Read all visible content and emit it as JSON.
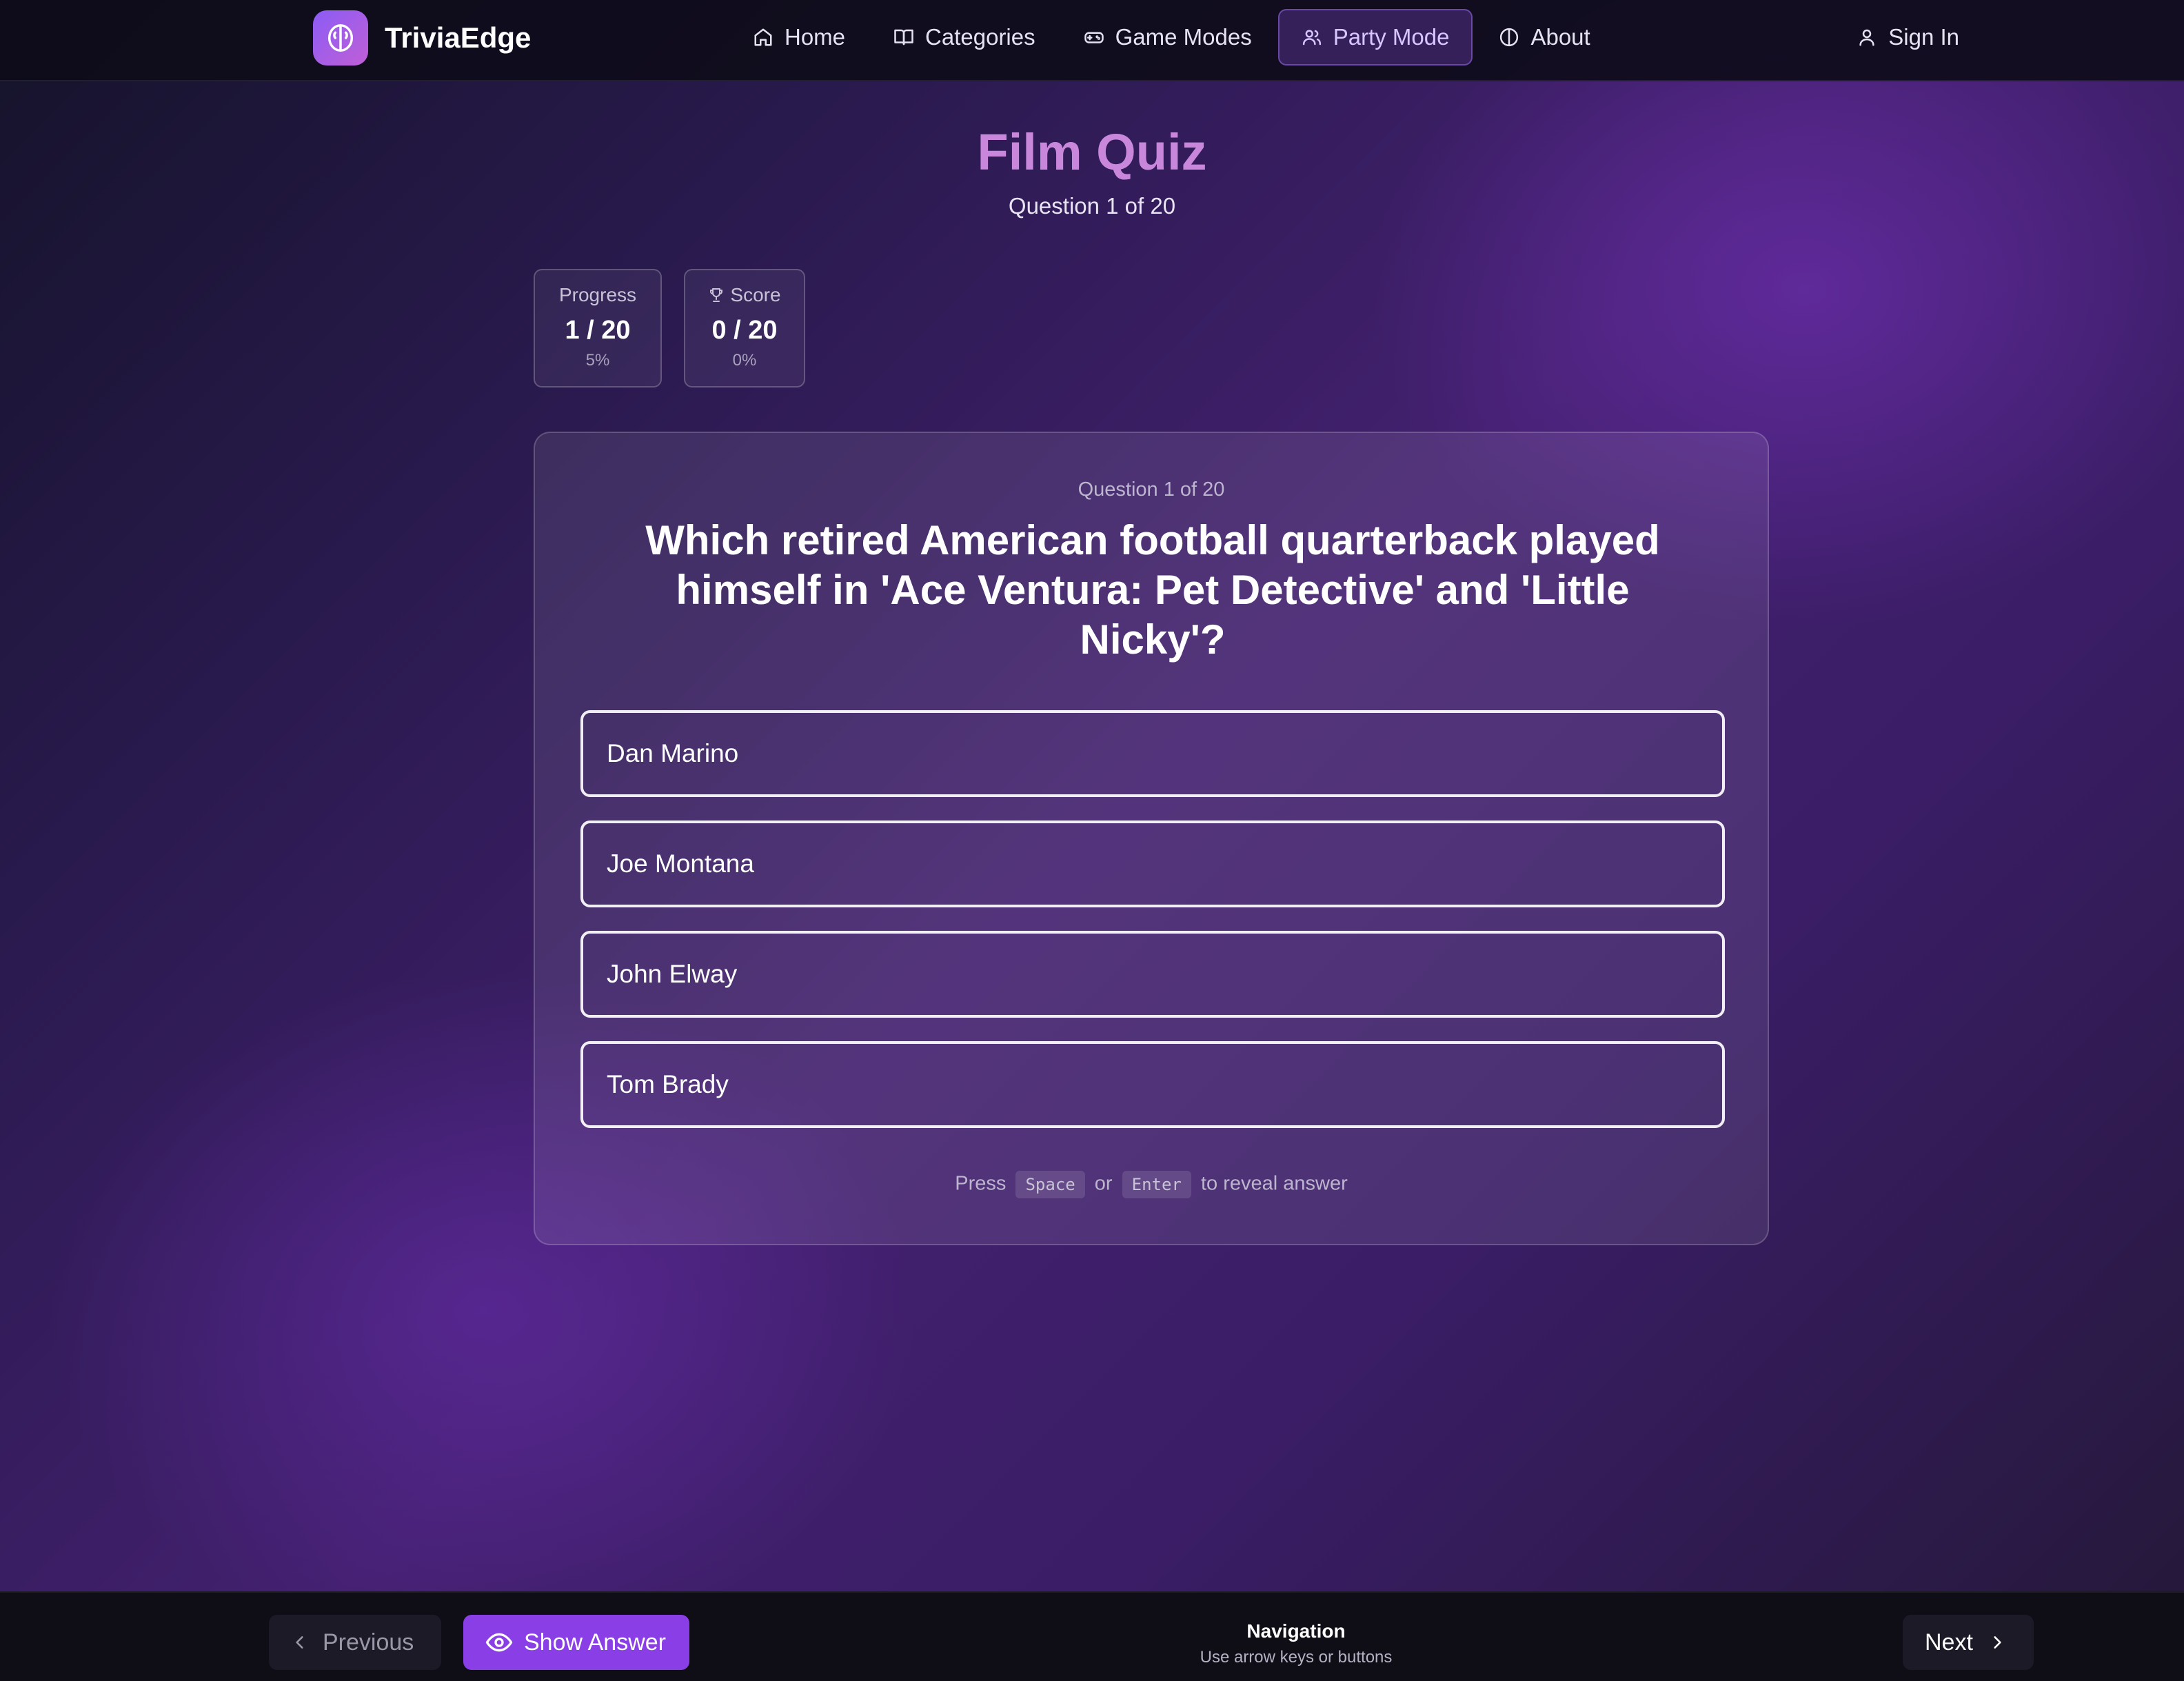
{
  "app": {
    "name": "TriviaEdge"
  },
  "nav": {
    "items": [
      {
        "label": "Home",
        "icon": "home-icon"
      },
      {
        "label": "Categories",
        "icon": "book-icon"
      },
      {
        "label": "Game Modes",
        "icon": "gamepad-icon"
      },
      {
        "label": "Party Mode",
        "icon": "users-icon",
        "active": true
      },
      {
        "label": "About",
        "icon": "info-icon"
      }
    ],
    "sign_in": "Sign In"
  },
  "header": {
    "title": "Film Quiz",
    "subtitle": "Question 1 of 20"
  },
  "stats": {
    "progress": {
      "label": "Progress",
      "value": "1 / 20",
      "percent": "5%"
    },
    "score": {
      "label": "Score",
      "value": "0 / 20",
      "percent": "0%"
    }
  },
  "question": {
    "counter": "Question 1 of 20",
    "text": "Which retired American football quarterback played himself in 'Ace Ventura: Pet Detective' and 'Little Nicky'?",
    "options": [
      "Dan Marino",
      "Joe Montana",
      "John Elway",
      "Tom Brady"
    ],
    "hint": {
      "press": "Press",
      "key1": "Space",
      "or": "or",
      "key2": "Enter",
      "suffix": "to reveal answer"
    }
  },
  "footer": {
    "previous": "Previous",
    "show_answer": "Show Answer",
    "nav_title": "Navigation",
    "nav_subtitle": "Use arrow keys or buttons",
    "next": "Next"
  },
  "colors": {
    "accent": "#8a3fe6",
    "title": "#c987dc",
    "logo_gradient_start": "#8b5cf6",
    "logo_gradient_end": "#c05fd6"
  }
}
